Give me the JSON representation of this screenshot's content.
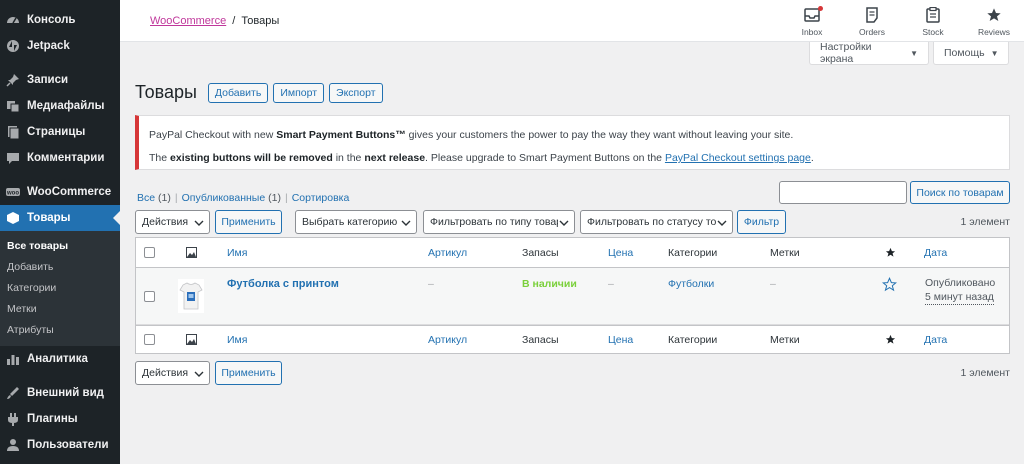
{
  "sidebar": {
    "items": [
      {
        "label": "Консоль",
        "icon": "dashboard-icon"
      },
      {
        "label": "Jetpack",
        "icon": "jetpack-icon"
      },
      {
        "label": "Записи",
        "icon": "pin-icon"
      },
      {
        "label": "Медиафайлы",
        "icon": "media-icon"
      },
      {
        "label": "Страницы",
        "icon": "page-icon"
      },
      {
        "label": "Комментарии",
        "icon": "comment-icon"
      },
      {
        "label": "WooCommerce",
        "icon": "woocommerce-icon"
      },
      {
        "label": "Товары",
        "icon": "products-icon"
      },
      {
        "label": "Аналитика",
        "icon": "analytics-icon"
      },
      {
        "label": "Внешний вид",
        "icon": "appearance-icon"
      },
      {
        "label": "Плагины",
        "icon": "plugin-icon"
      },
      {
        "label": "Пользователи",
        "icon": "users-icon"
      }
    ],
    "submenu": [
      "Все товары",
      "Добавить",
      "Категории",
      "Метки",
      "Атрибуты"
    ]
  },
  "header": {
    "breadcrumb_link": "WooCommerce",
    "breadcrumb_sep": "/",
    "breadcrumb_current": "Товары",
    "activity": [
      {
        "label": "Inbox",
        "icon": "inbox-icon"
      },
      {
        "label": "Orders",
        "icon": "orders-icon"
      },
      {
        "label": "Stock",
        "icon": "stock-icon"
      },
      {
        "label": "Reviews",
        "icon": "star-icon"
      }
    ],
    "screen_options": "Настройки экрана",
    "help": "Помощь"
  },
  "page": {
    "title": "Товары",
    "buttons": [
      "Добавить",
      "Импорт",
      "Экспорт"
    ]
  },
  "notice": {
    "line1_pre": "PayPal Checkout with new ",
    "line1_bold": "Smart Payment Buttons™",
    "line1_post": " gives your customers the power to pay the way they want without leaving your site.",
    "line2_pre": "The ",
    "line2_bold1": "existing buttons will be removed",
    "line2_mid": " in the ",
    "line2_bold2": "next release",
    "line2_post": ". Please upgrade to Smart Payment Buttons on the ",
    "line2_link": "PayPal Checkout settings page",
    "line2_end": "."
  },
  "filters": {
    "views": [
      {
        "label": "Все",
        "count": "(1)"
      },
      {
        "label": "Опубликованные",
        "count": "(1)"
      },
      {
        "label": "Сортировка",
        "count": ""
      }
    ],
    "search_button": "Поиск по товарам",
    "bulk_action": "Действия",
    "apply": "Применить",
    "category": "Выбрать категорию",
    "product_type": "Фильтровать по типу товара",
    "stock_status": "Фильтровать по статусу товара",
    "filter_button": "Фильтр",
    "items_count": "1 элемент"
  },
  "table": {
    "columns": {
      "name": "Имя",
      "sku": "Артикул",
      "stock": "Запасы",
      "price": "Цена",
      "categories": "Категории",
      "tags": "Метки",
      "date": "Дата"
    },
    "rows": [
      {
        "name": "Футболка с принтом",
        "sku": "–",
        "stock": "В наличии",
        "price": "–",
        "categories": "Футболки",
        "tags": "–",
        "status": "Опубликовано",
        "date": "5 минут назад"
      }
    ]
  },
  "colors": {
    "sidebar_bg": "#1d2327",
    "accent": "#2271b1",
    "notice_border": "#d63638",
    "in_stock": "#7ad03a",
    "breadcrumb_link": "#c0379b"
  }
}
